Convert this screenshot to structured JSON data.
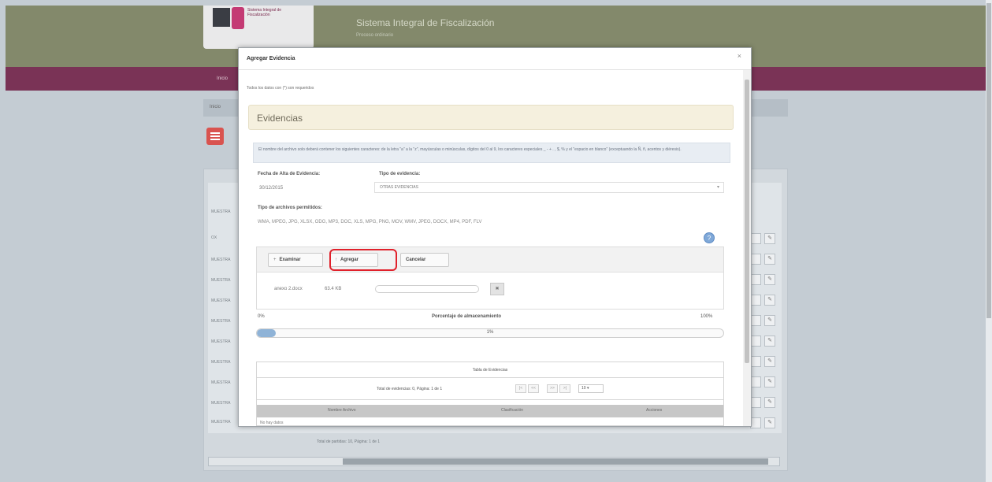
{
  "app": {
    "logo_text": "Sistema Integral de Fiscalización",
    "title": "Sistema Integral de Fiscalización",
    "subtitle": "Proceso ordinario",
    "nav_item": "Inicio",
    "breadcrumb": "Inicio",
    "row_labels": [
      "MUESTRA",
      "OX",
      "MUESTRA",
      "MUESTRA",
      "MUESTRA",
      "MUESTRA",
      "MUESTRA",
      "MUESTRA",
      "MUESTRA",
      "MUESTRA",
      "MUESTRA"
    ],
    "pager_text": "Total de partidas: 10, Página: 1 de 1"
  },
  "modal": {
    "title": "Agregar Evidencia",
    "close": "×",
    "required_note": "Todos los datos con (*) son requeridos",
    "panel_title": "Evidencias",
    "info_text": "El nombre del archivo solo deberá contener los siguientes caracteres: de la letra \"a\" a la \"z\", mayúsculas o minúsculas, dígitos del 0 al 9, los caracteres especiales _ - + . , $, % y el \"espacio en blanco\" (exceptuando la Ñ, ñ, acentos y diéresis).",
    "fecha_label": "Fecha de Alta de Evidencia:",
    "fecha_value": "30/12/2015",
    "tipo_label": "Tipo de evidencia:",
    "tipo_value": "OTRAS EVIDENCIAS",
    "tipo_archivos_label": "Tipo de archivos permitidos:",
    "tipo_archivos_value": "WMA, MPEG, JPG, XLSX, ODG, MP3, DOC, XLS, MPG, PNG, MOV, WMV, JPEG, DOCX, MP4, PDF, FLV"
  },
  "upload": {
    "examinar": "Examinar",
    "agregar": "Agregar",
    "cancelar": "Cancelar",
    "file_name": "anexo 2.docx",
    "file_size": "63.4 KB",
    "remove": "✖"
  },
  "storage": {
    "min_label": "0%",
    "label": "Porcentaje de almacenamiento",
    "max_label": "100%",
    "percent_text": "1%",
    "percent_value": 0.04
  },
  "evidence_table": {
    "caption": "Tabla de Evidencias",
    "pager_text": "Total de evidencias: 0, Página: 1 de 1",
    "page_size": "10",
    "columns": [
      "Nombre Archivo",
      "Clasificación",
      "Acciones"
    ],
    "empty_text": "No hay datos"
  }
}
